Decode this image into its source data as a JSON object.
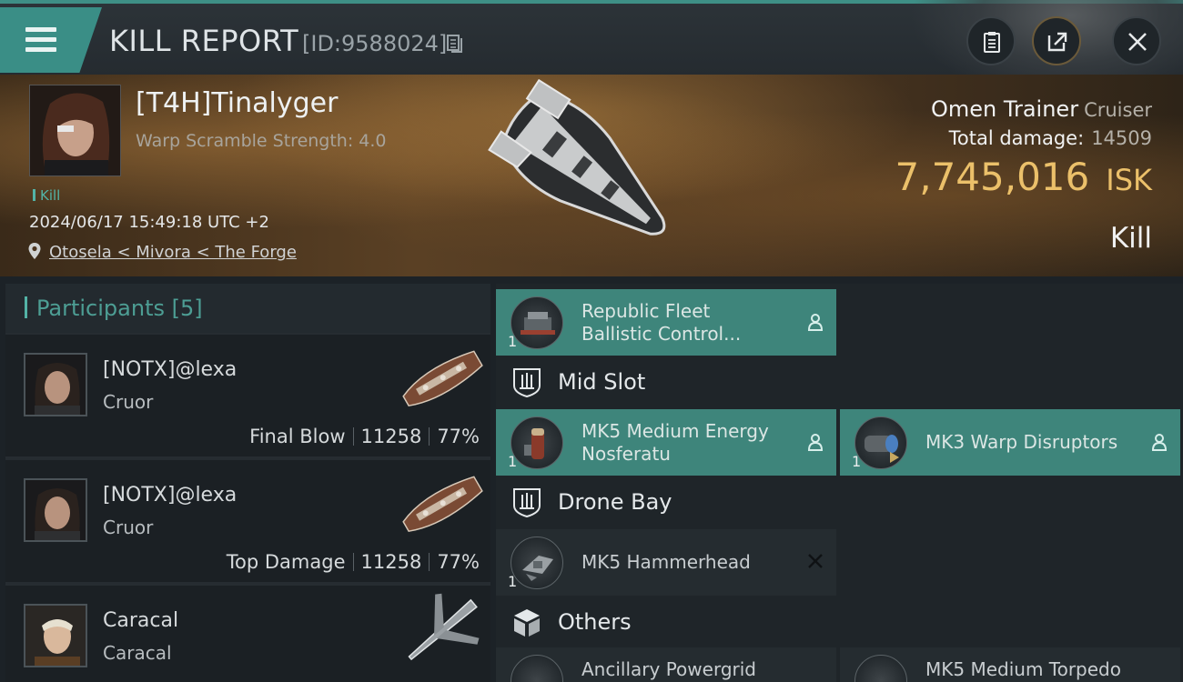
{
  "header": {
    "title": "KILL REPORT",
    "report_id": "[ID:9588024]"
  },
  "victim": {
    "name": "[T4H]Tinalyger",
    "warp_scramble": "Warp Scramble Strength: 4.0",
    "kill_tag": "Kill",
    "timestamp": "2024/06/17 15:49:18 UTC +2",
    "location": "Otosela < Mivora < The Forge",
    "ship_name": "Omen Trainer",
    "ship_class": "Cruiser",
    "total_damage_label": "Total damage:",
    "total_damage": "14509",
    "isk_value": "7,745,016",
    "isk_unit": "ISK",
    "result": "Kill"
  },
  "participants": {
    "title": "Participants",
    "count": "[5]",
    "items": [
      {
        "name": "[NOTX]@lexa",
        "ship": "Cruor",
        "role": "Final Blow",
        "damage": "11258",
        "percent": "77%"
      },
      {
        "name": "[NOTX]@lexa",
        "ship": "Cruor",
        "role": "Top Damage",
        "damage": "11258",
        "percent": "77%"
      },
      {
        "name": "Caracal",
        "ship": "Caracal"
      }
    ]
  },
  "fitting": {
    "low_modules": [
      {
        "name_line1": "Republic Fleet",
        "name_line2": "Ballistic Control...",
        "qty": "1"
      }
    ],
    "mid_slot": {
      "label": "Mid Slot",
      "modules": [
        {
          "name_line1": "MK5 Medium Energy",
          "name_line2": "Nosferatu",
          "qty": "1"
        },
        {
          "name_line1": "MK3 Warp Disruptors",
          "qty": "1"
        }
      ]
    },
    "drone_bay": {
      "label": "Drone Bay",
      "modules": [
        {
          "name_line1": "MK5  Hammerhead",
          "qty": "1"
        }
      ]
    },
    "others": {
      "label": "Others",
      "modules": [
        {
          "name_line1": "Ancillary Powergrid"
        },
        {
          "name_line1": "MK5 Medium Torpedo"
        }
      ]
    }
  },
  "colors": {
    "accent": "#53b3a6",
    "active_module": "#3e857b",
    "isk": "#ebc06a"
  }
}
